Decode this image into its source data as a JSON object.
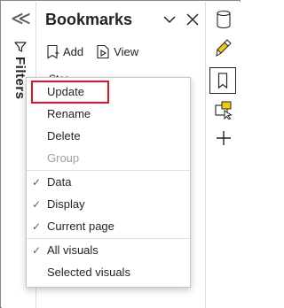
{
  "filters": {
    "label": "Filters",
    "collapse_glyph": "≪"
  },
  "bookmarks": {
    "title": "Bookmarks",
    "add_label": "Add",
    "view_label": "View",
    "item_fragment": "Stor"
  },
  "menu": {
    "items": [
      {
        "label": "Update",
        "checked": false,
        "disabled": false,
        "highlighted": true
      },
      {
        "label": "Rename",
        "checked": false,
        "disabled": false
      },
      {
        "label": "Delete",
        "checked": false,
        "disabled": false
      },
      {
        "label": "Group",
        "checked": false,
        "disabled": true
      },
      {
        "label": "Data",
        "checked": true,
        "disabled": false
      },
      {
        "label": "Display",
        "checked": true,
        "disabled": false
      },
      {
        "label": "Current page",
        "checked": true,
        "disabled": false
      },
      {
        "label": "All visuals",
        "checked": true,
        "disabled": false
      },
      {
        "label": "Selected visuals",
        "checked": false,
        "disabled": false
      }
    ],
    "check_glyph": "✓"
  },
  "right_rail": {
    "icons": [
      "database-icon",
      "format-paintbrush-icon",
      "bookmark-icon",
      "selection-pane-icon",
      "plus-icon"
    ]
  },
  "colors": {
    "highlight": "#e81123",
    "disabled_text": "#a19f9d",
    "accent": "#f2c811"
  }
}
